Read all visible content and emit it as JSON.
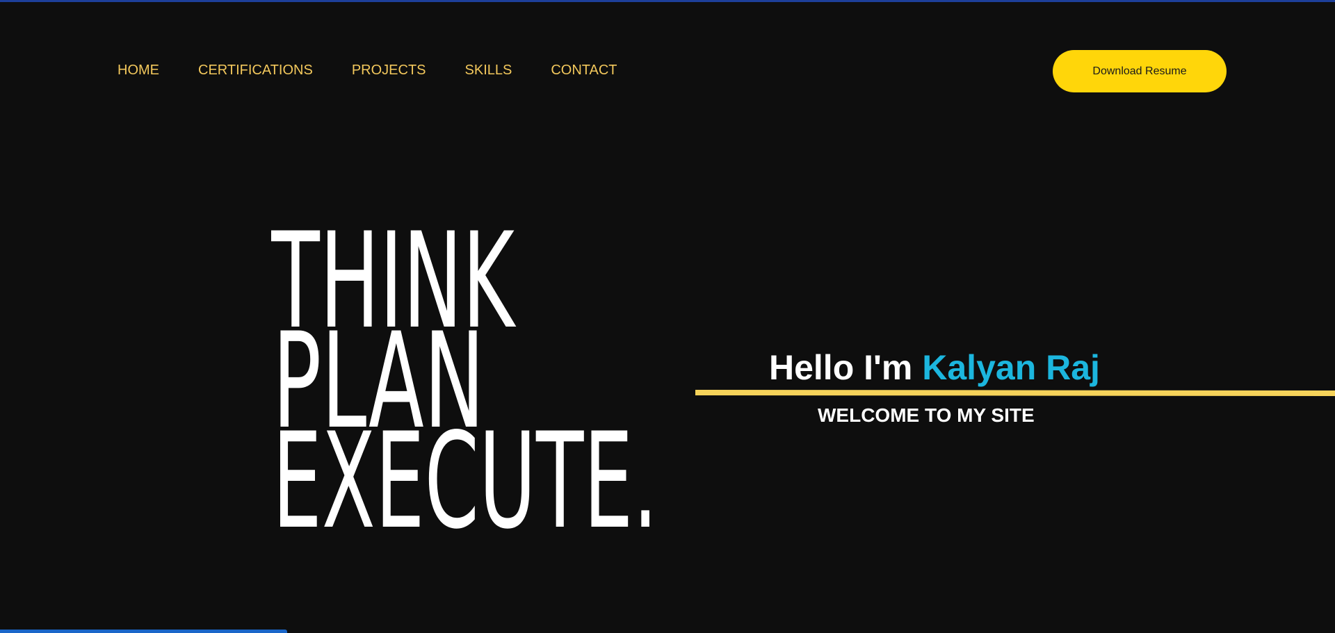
{
  "nav": {
    "items": [
      {
        "label": "HOME"
      },
      {
        "label": "CERTIFICATIONS"
      },
      {
        "label": "PROJECTS"
      },
      {
        "label": "SKILLS"
      },
      {
        "label": "CONTACT"
      }
    ]
  },
  "header": {
    "resume_button_label": "Download Resume"
  },
  "hero": {
    "slogan_lines": [
      "THINK",
      "PLAN",
      "EXECUTE."
    ],
    "greeting_prefix": "Hello I'm ",
    "name": "Kalyan Raj",
    "subtitle": "WELCOME TO MY SITE"
  },
  "scroll_progress": 0.215,
  "colors": {
    "background": "#0e0e0e",
    "nav_text": "#f3c85c",
    "button": "#ffd60a",
    "name_accent": "#1cb6de",
    "accent_line": "#f6d35a",
    "top_bar": "#1d3f9a",
    "progress": "#1a66c9"
  }
}
